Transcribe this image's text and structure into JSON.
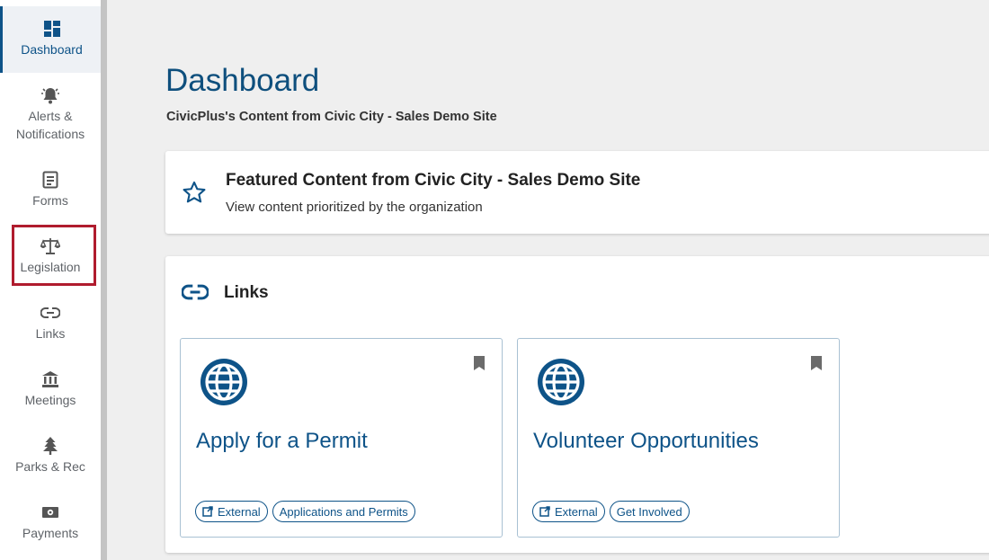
{
  "sidebar": {
    "items": [
      {
        "label": "Dashboard",
        "icon": "dashboard-icon"
      },
      {
        "label": "Alerts &\nNotifications",
        "icon": "bell-icon"
      },
      {
        "label": "Forms",
        "icon": "form-icon"
      },
      {
        "label": "Legislation",
        "icon": "scales-icon"
      },
      {
        "label": "Links",
        "icon": "link-icon"
      },
      {
        "label": "Meetings",
        "icon": "building-icon"
      },
      {
        "label": "Parks & Rec",
        "icon": "tree-icon"
      },
      {
        "label": "Payments",
        "icon": "money-icon"
      }
    ]
  },
  "header": {
    "title": "Dashboard",
    "subtitle": "CivicPlus's Content from Civic City - Sales Demo Site"
  },
  "featured": {
    "title": "Featured Content from Civic City - Sales Demo Site",
    "description": "View content prioritized by the organization"
  },
  "links": {
    "title": "Links",
    "tiles": [
      {
        "title": "Apply for a Permit",
        "tags": [
          "External",
          "Applications and Permits"
        ]
      },
      {
        "title": "Volunteer Opportunities",
        "tags": [
          "External",
          "Get Involved"
        ]
      }
    ]
  },
  "colors": {
    "accent": "#0e5388",
    "highlight": "#b01c2e",
    "background": "#efefef"
  }
}
